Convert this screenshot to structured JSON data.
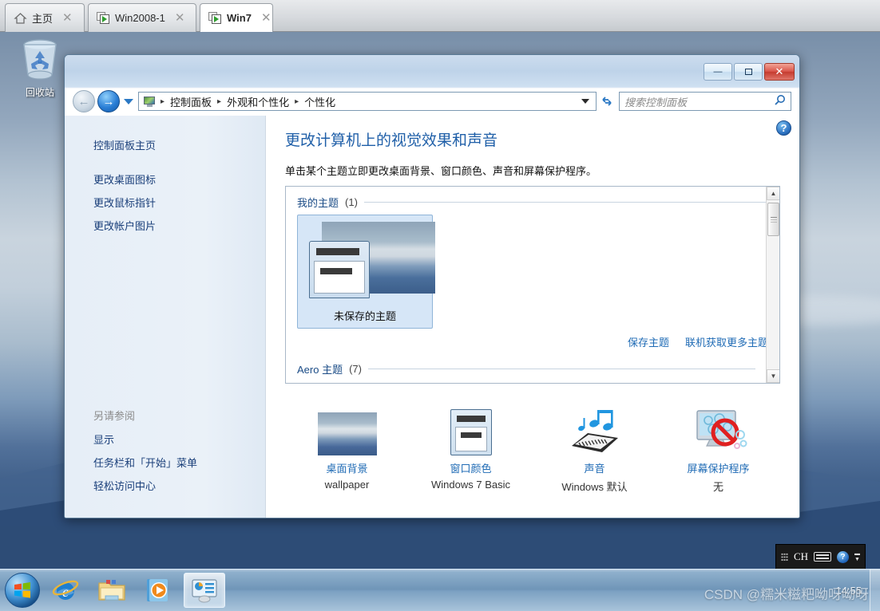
{
  "tabs": [
    {
      "label": "主页",
      "icon": "home-icon",
      "active": false,
      "close": "✕"
    },
    {
      "label": "Win2008-1",
      "icon": "vm-icon",
      "active": false,
      "close": "✕"
    },
    {
      "label": "Win7",
      "icon": "vm-icon",
      "active": true,
      "close": "✕"
    }
  ],
  "desktop": {
    "recycle_bin_label": "回收站"
  },
  "window": {
    "buttons": {
      "minimize": "—",
      "maximize": "❐",
      "close": "✕"
    },
    "breadcrumbs": [
      "控制面板",
      "外观和个性化",
      "个性化"
    ],
    "breadcrumb_separator": "▸",
    "search_placeholder": "搜索控制面板",
    "search_icon": "search-icon",
    "refresh_icon": "↻",
    "back_icon": "←",
    "forward_icon": "→",
    "help_icon": "?"
  },
  "sidebar": {
    "primary": [
      {
        "label": "控制面板主页"
      },
      {
        "label": "更改桌面图标"
      },
      {
        "label": "更改鼠标指针"
      },
      {
        "label": "更改帐户图片"
      }
    ],
    "see_also_header": "另请参阅",
    "see_also": [
      {
        "label": "显示"
      },
      {
        "label": "任务栏和「开始」菜单"
      },
      {
        "label": "轻松访问中心"
      }
    ]
  },
  "content": {
    "heading": "更改计算机上的视觉效果和声音",
    "subheading": "单击某个主题立即更改桌面背景、窗口颜色、声音和屏幕保护程序。",
    "groups": [
      {
        "name": "我的主题",
        "count": "(1)"
      },
      {
        "name": "Aero 主题",
        "count": "(7)"
      }
    ],
    "themes": [
      {
        "name": "未保存的主题",
        "selected": true
      }
    ],
    "box_links": [
      {
        "label": "保存主题"
      },
      {
        "label": "联机获取更多主题"
      }
    ],
    "settings": [
      {
        "label": "桌面背景",
        "value": "wallpaper",
        "icon": "wallpaper-icon"
      },
      {
        "label": "窗口颜色",
        "value": "Windows 7 Basic",
        "icon": "window-color-icon"
      },
      {
        "label": "声音",
        "value": "Windows 默认",
        "icon": "sound-icon"
      },
      {
        "label": "屏幕保护程序",
        "value": "无",
        "icon": "screensaver-icon"
      }
    ]
  },
  "taskbar": {
    "start_label": "start-orb",
    "buttons": [
      {
        "name": "internet-explorer",
        "active": false
      },
      {
        "name": "windows-explorer",
        "active": false
      },
      {
        "name": "media-player",
        "active": false
      },
      {
        "name": "control-panel",
        "active": true
      }
    ],
    "tray": {
      "language": "CH",
      "keyboard_icon": "keyboard-icon",
      "help_icon": "?",
      "clock": "14:55"
    }
  },
  "watermark": "CSDN @糯米糍粑呦呀呦呀"
}
